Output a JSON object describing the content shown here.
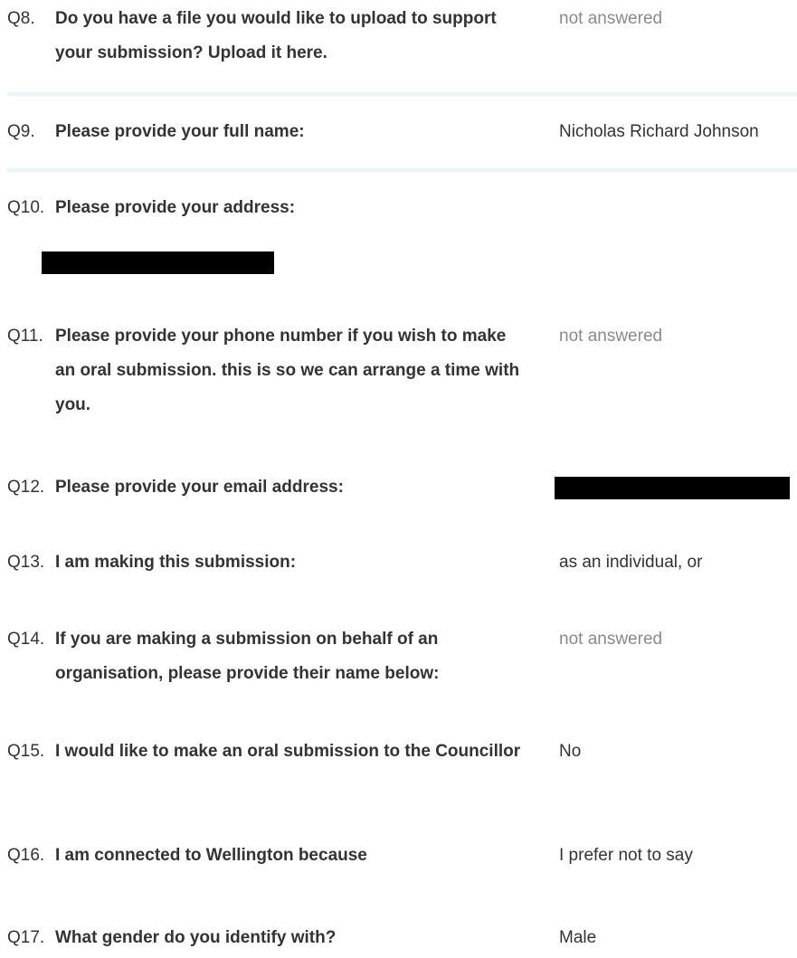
{
  "questions": [
    {
      "num": "Q8.",
      "text": "Do you have a file you would like to upload to support your submission? Upload it here.",
      "answer": "not answered"
    },
    {
      "num": "Q9.",
      "text": "Please provide your full name:",
      "answer": "Nicholas Richard Johnson"
    },
    {
      "num": "Q10.",
      "text": "Please provide your address:",
      "answer": ""
    },
    {
      "num": "Q11.",
      "text": "Please provide your phone number if you wish to make an oral submission. this is so we can arrange a time with you.",
      "answer": "not answered"
    },
    {
      "num": "Q12.",
      "text": "Please provide your email address:",
      "answer": ""
    },
    {
      "num": "Q13.",
      "text": "I am making this submission:",
      "answer": "as an individual, or"
    },
    {
      "num": "Q14.",
      "text": "If you are making a submission on behalf of an organisation, please provide their name below:",
      "answer": "not answered"
    },
    {
      "num": "Q15.",
      "text": "I would like to make an oral submission to the Councillor",
      "answer": "No"
    },
    {
      "num": "Q16.",
      "text": "I am connected to Wellington because",
      "answer": "I prefer not to say"
    },
    {
      "num": "Q17.",
      "text": "What gender do you identify with?",
      "answer": "Male"
    }
  ]
}
